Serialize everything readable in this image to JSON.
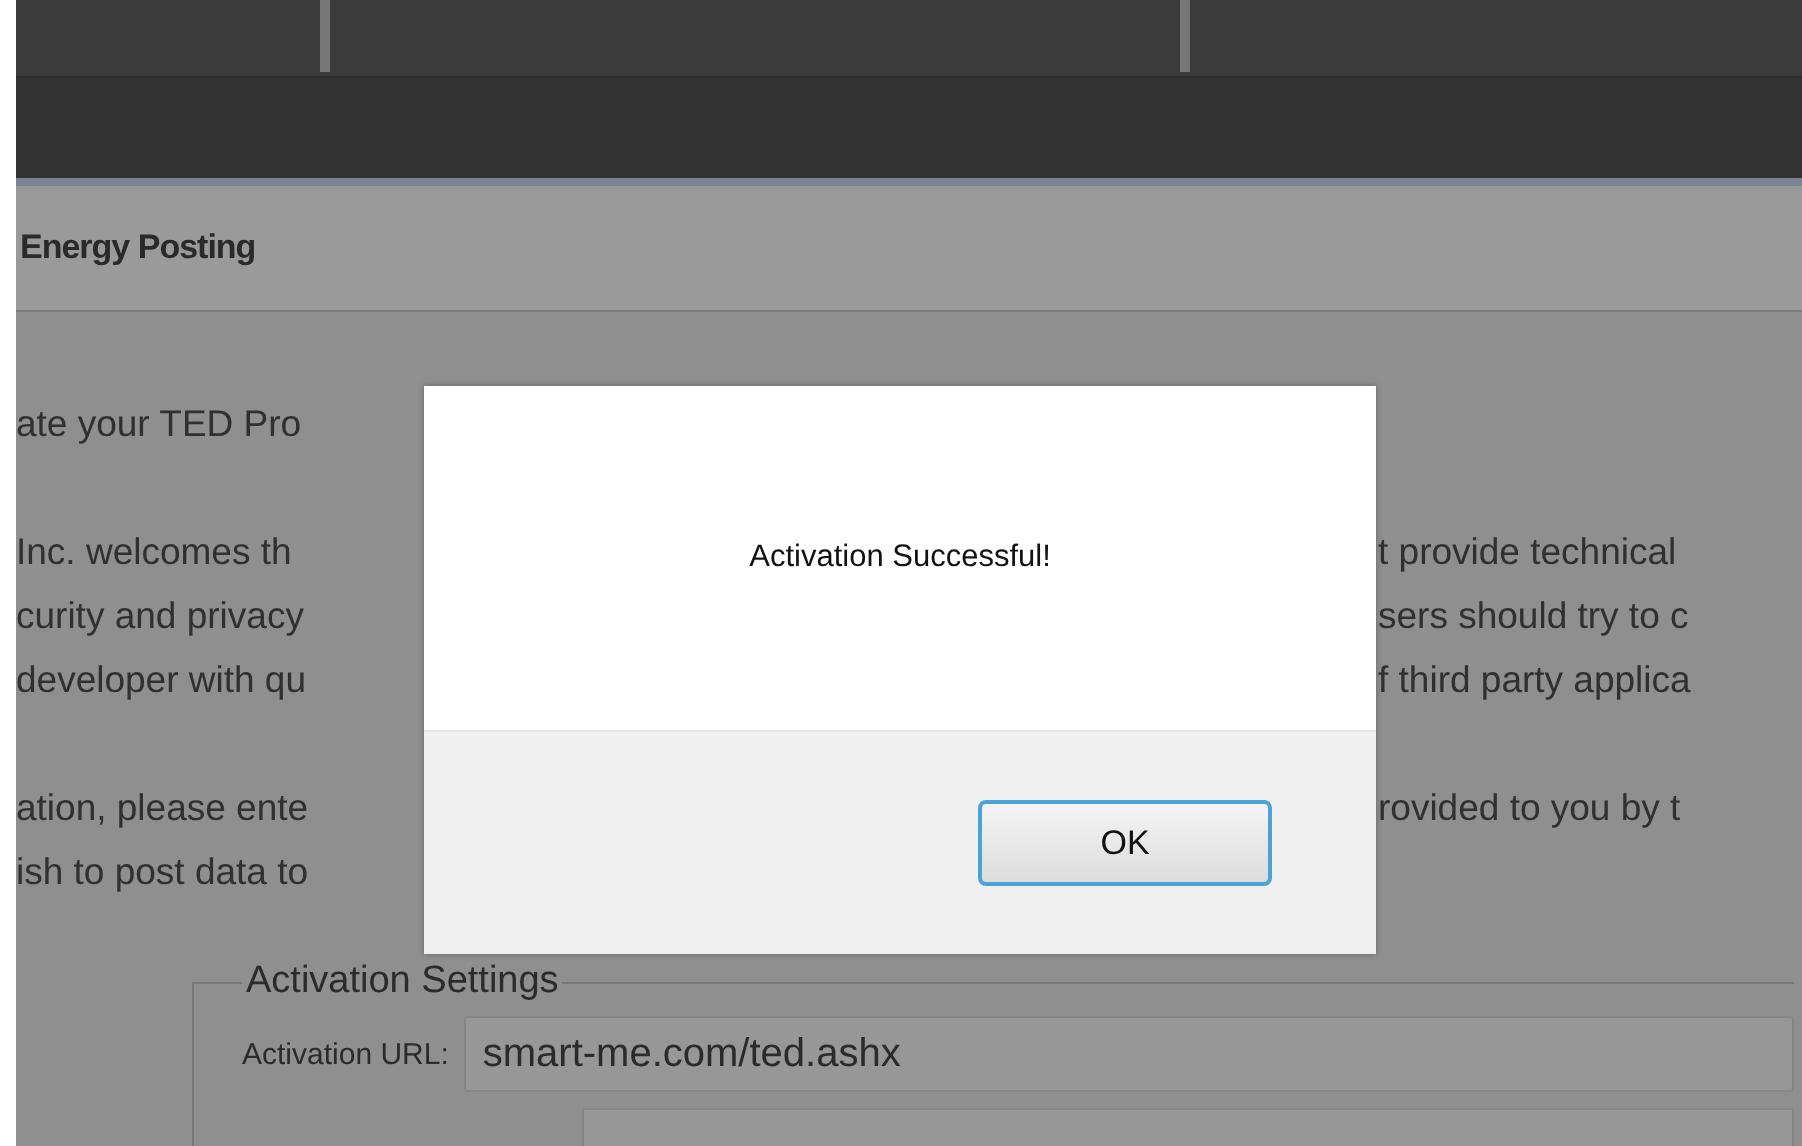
{
  "header": {
    "title": "Energy Posting"
  },
  "paragraphs": [
    {
      "lines": [
        {
          "left": "ate your TED Pro"
        }
      ]
    },
    {
      "lines": [
        {
          "left": "Inc. welcomes th",
          "right": "t provide technical"
        },
        {
          "left": "curity and privacy",
          "right": "sers should try to c"
        },
        {
          "left": "developer with qu",
          "right": "f third party applica"
        }
      ]
    },
    {
      "lines": [
        {
          "left": "ation, please ente",
          "right": "rovided to you by t"
        },
        {
          "left": "ish to post data to"
        }
      ]
    }
  ],
  "settings": {
    "legend": "Activation Settings",
    "fields": [
      {
        "label": "Activation URL:",
        "value": "smart-me.com/ted.ashx"
      }
    ]
  },
  "dialog": {
    "message": "Activation Successful!",
    "button": "OK"
  }
}
